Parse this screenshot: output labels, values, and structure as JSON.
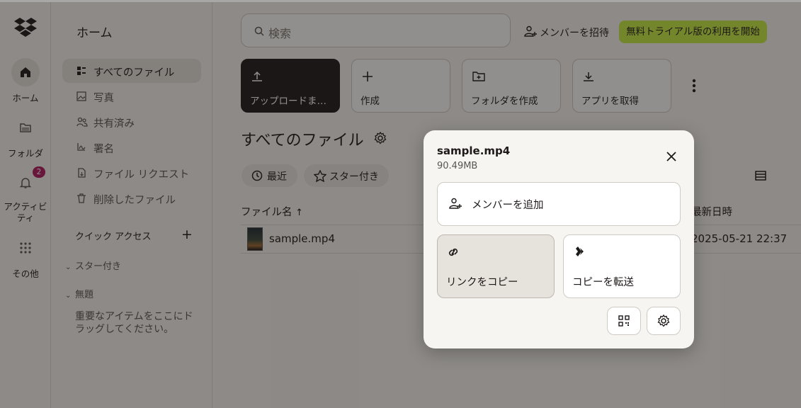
{
  "rail": {
    "items": [
      {
        "label": "ホーム",
        "icon": "home-icon"
      },
      {
        "label": "フォルダ",
        "icon": "folder-icon"
      },
      {
        "label": "アクティビティ",
        "icon": "bell-icon",
        "badge": "2"
      },
      {
        "label": "その他",
        "icon": "grid-icon"
      }
    ]
  },
  "nav": {
    "title": "ホーム",
    "items": [
      {
        "label": "すべてのファイル",
        "icon": "files-icon"
      },
      {
        "label": "写真",
        "icon": "photo-icon"
      },
      {
        "label": "共有済み",
        "icon": "shared-icon"
      },
      {
        "label": "署名",
        "icon": "signature-icon"
      },
      {
        "label": "ファイル リクエスト",
        "icon": "file-request-icon"
      },
      {
        "label": "削除したファイル",
        "icon": "trash-icon"
      }
    ],
    "quick_access": "クイック アクセス",
    "starred": "スター付き",
    "untitled": "無題",
    "hint": "重要なアイテムをここにドラッグしてください。"
  },
  "header": {
    "search_placeholder": "検索",
    "invite": "メンバーを招待",
    "trial": "無料トライアル版の利用を開始"
  },
  "actions": [
    {
      "label": "アップロードまたはドロップ",
      "display": "アップロードまた...",
      "icon": "upload-icon"
    },
    {
      "label": "作成",
      "icon": "plus-icon"
    },
    {
      "label": "フォルダを作成",
      "icon": "folder-plus-icon"
    },
    {
      "label": "アプリを取得",
      "icon": "download-icon"
    }
  ],
  "section": {
    "title": "すべてのファイル",
    "filters": [
      "最近",
      "スター付き"
    ]
  },
  "table": {
    "col_name": "ファイル名",
    "col_date": "最新日時",
    "rows": [
      {
        "name": "sample.mp4",
        "date": "2025-05-21 22:37"
      }
    ]
  },
  "modal": {
    "file_name": "sample.mp4",
    "file_size": "90.49MB",
    "add_member": "メンバーを追加",
    "copy_link": "リンクをコピー",
    "transfer": "コピーを転送"
  },
  "colors": {
    "accent": "#c7ee42",
    "badge": "#b0185d",
    "dark_tile": "#1e1919"
  }
}
